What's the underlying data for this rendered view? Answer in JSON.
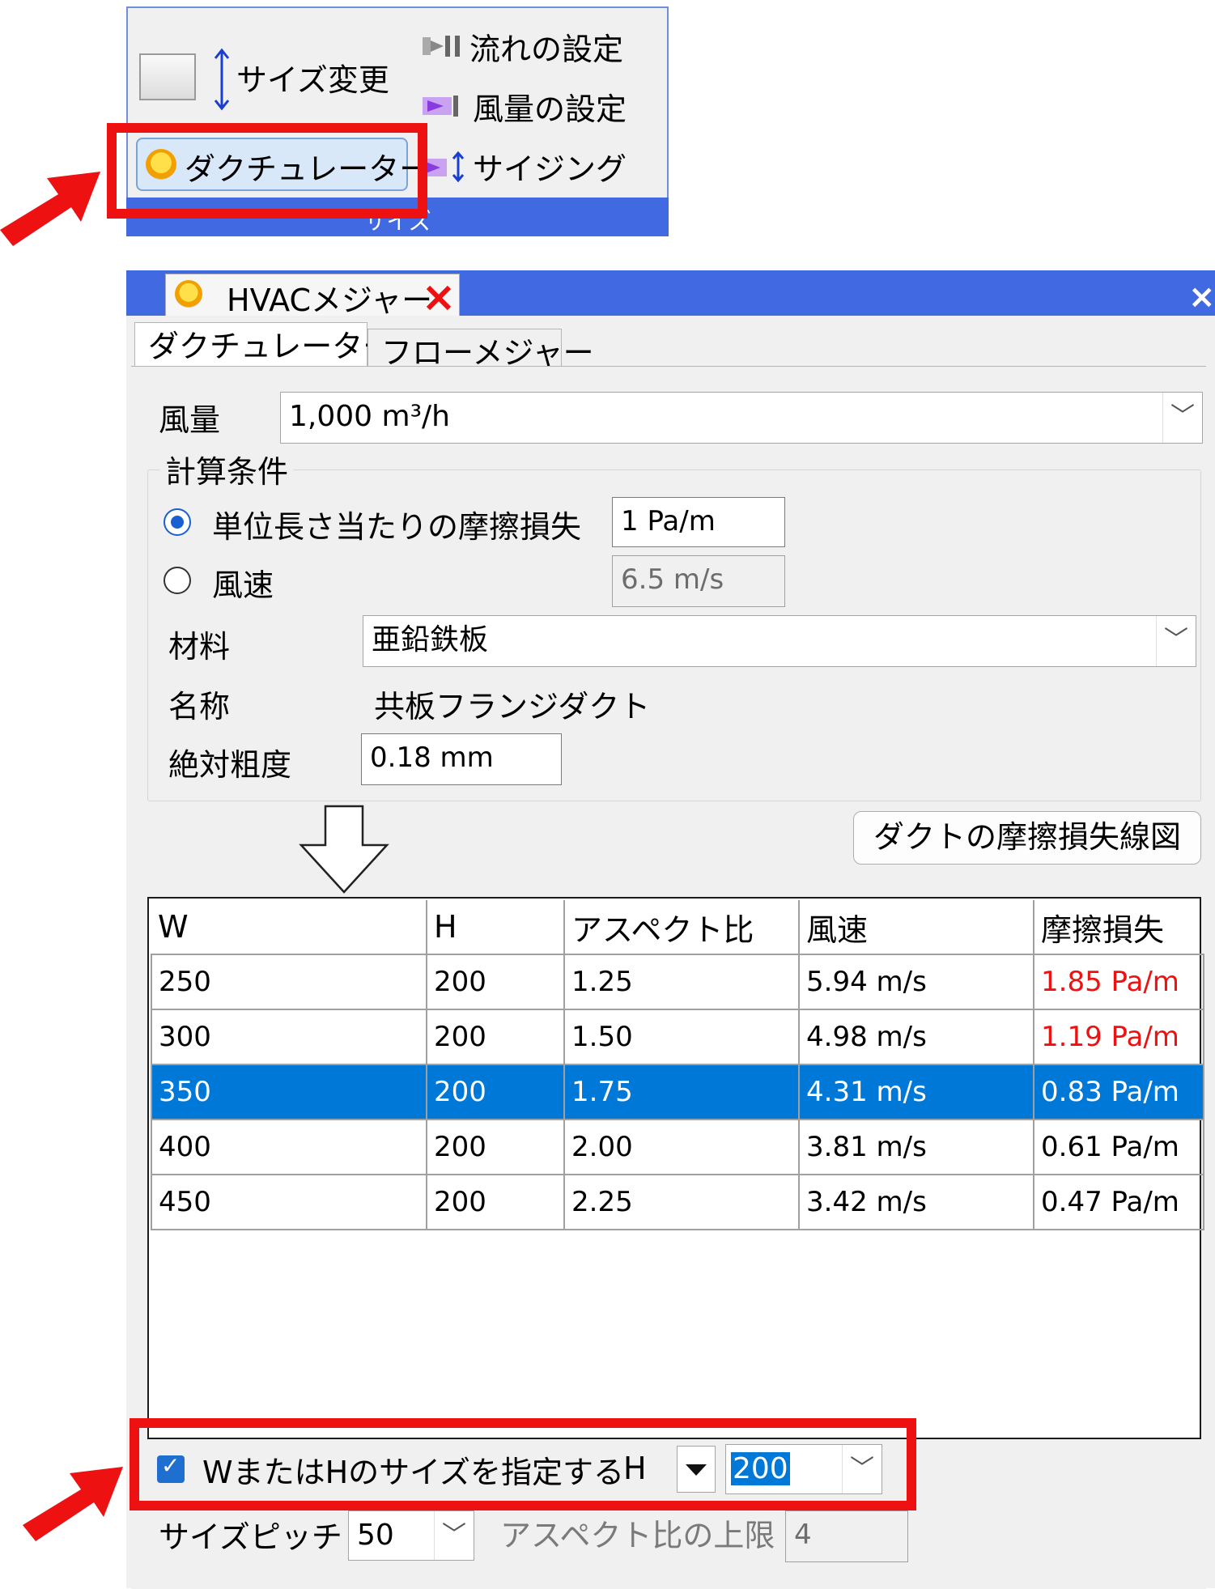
{
  "ribbon": {
    "resize_label": "サイズ変更",
    "flow_settings_label": "流れの設定",
    "airflow_settings_label": "風量の設定",
    "ductulator_label": "ダクチュレーター",
    "sizing_label": "サイジング",
    "group_label": "サイズ"
  },
  "dialog": {
    "tab_title": "HVACメジャー",
    "close_glyph": "×",
    "tabs": [
      "ダクチュレーター",
      "フローメジャー"
    ],
    "airflow": {
      "label": "風量",
      "value": "1,000 m³/h"
    },
    "conditions": {
      "title": "計算条件",
      "friction_label": "単位長さ当たりの摩擦損失",
      "friction_value": "1 Pa/m",
      "velocity_label": "風速",
      "velocity_value": "6.5 m/s",
      "material_label": "材料",
      "material_value": "亜鉛鉄板",
      "name_label": "名称",
      "name_value": "共板フランジダクト",
      "roughness_label": "絶対粗度",
      "roughness_value": "0.18 mm"
    },
    "friction_chart_button": "ダクトの摩擦損失線図",
    "table": {
      "headers": [
        "W",
        "H",
        "アスペクト比",
        "風速",
        "摩擦損失"
      ],
      "rows": [
        [
          "250",
          "200",
          "1.25",
          "5.94 m/s",
          "1.85 Pa/m"
        ],
        [
          "300",
          "200",
          "1.50",
          "4.98 m/s",
          "1.19 Pa/m"
        ],
        [
          "350",
          "200",
          "1.75",
          "4.31 m/s",
          "0.83 Pa/m"
        ],
        [
          "400",
          "200",
          "2.00",
          "3.81 m/s",
          "0.61 Pa/m"
        ],
        [
          "450",
          "200",
          "2.25",
          "3.42 m/s",
          "0.47 Pa/m"
        ]
      ],
      "selected_row": 2,
      "warning_color": "#ee1111"
    },
    "specify": {
      "checkbox_label": "WまたはHのサイズを指定する",
      "dimension": "H",
      "value": "200"
    },
    "size_pitch": {
      "label": "サイズピッチ",
      "value": "50"
    },
    "aspect_limit": {
      "label": "アスペクト比の上限",
      "value": "4"
    }
  },
  "colors": {
    "accent_blue": "#4169e1",
    "selection_blue": "#0078d7",
    "highlight_red": "#ee1111"
  }
}
